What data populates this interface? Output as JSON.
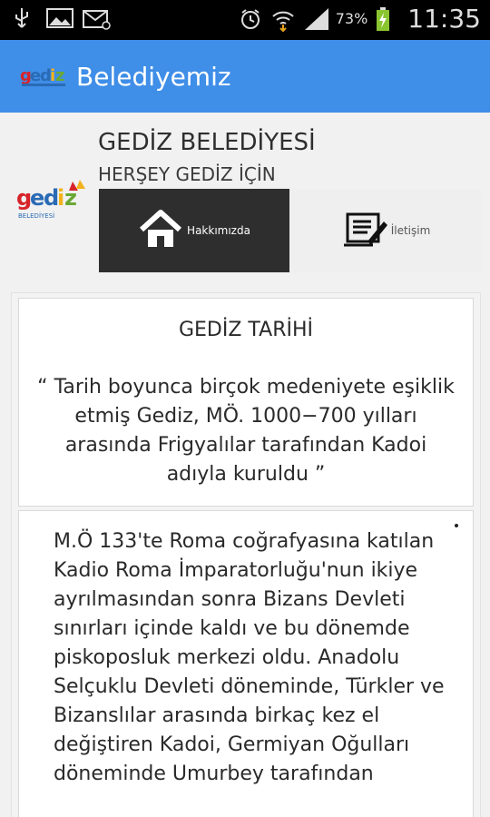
{
  "statusbar": {
    "battery_percent": "73%",
    "clock": "11:35"
  },
  "actionbar": {
    "title": "Belediyemiz",
    "logo_text": "gediz"
  },
  "header": {
    "organization": "GEDİZ BELEDİYESİ",
    "slogan": "HERŞEY GEDİZ İÇİN",
    "logo_text": "gediz",
    "logo_subtext": "BELEDİYESİ"
  },
  "nav": {
    "about_label": "Hakkımızda",
    "contact_label": "İletişim"
  },
  "history_card": {
    "title": "GEDİZ TARİHİ",
    "quote": "“ Tarih boyunca birçok medeniyete eşiklik etmiş Gediz, MÖ. 1000−700 yılları arasında Frigyalılar tarafından Kadoi adıyla kuruldu ”"
  },
  "history_text": "M.Ö 133'te Roma coğrafyasına katılan Kadio Roma İmparatorluğu'nun ikiye ayrılmasından sonra Bizans Devleti sınırları içinde kaldı ve bu dönemde piskoposluk merkezi oldu. Anadolu Selçuklu Devleti döneminde, Türkler ve Bizanslılar arasında birkaç kez el değiştiren Kadoi, Germiyan Oğulları döneminde Umurbey tarafından",
  "colors": {
    "actionbar": "#3f8ee8",
    "nav_active": "#2e2e2e",
    "nav_inactive": "#efefef"
  }
}
